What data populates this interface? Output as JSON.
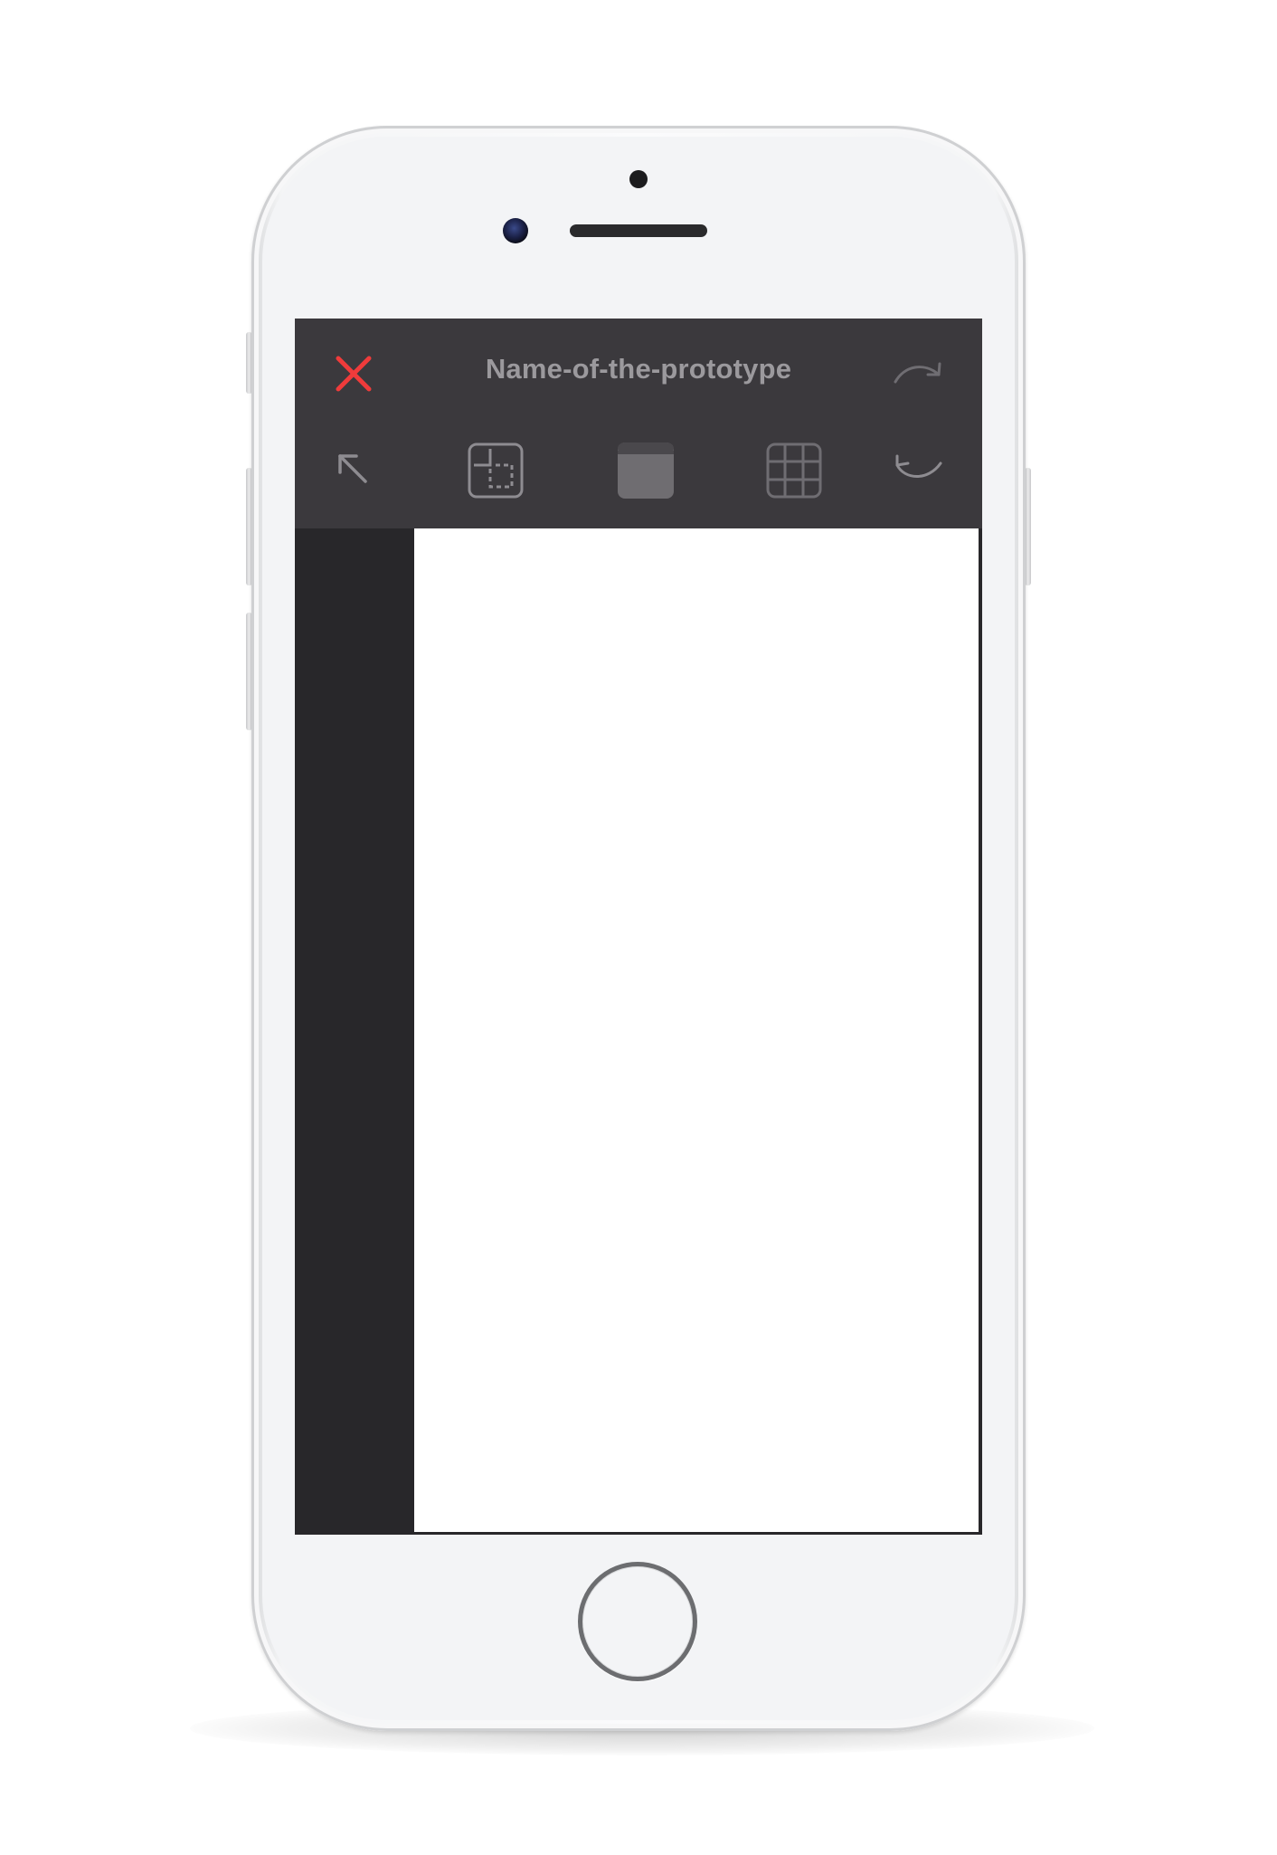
{
  "prototype": {
    "title": "Name-of-the-prototype"
  },
  "toolbar": {
    "top_row": [
      {
        "name": "close-icon",
        "color": "#ef3b3b"
      },
      {
        "name": "redo-icon"
      }
    ],
    "bottom_row": [
      {
        "name": "arrow-up-left-icon"
      },
      {
        "name": "crop-frame-icon"
      },
      {
        "name": "header-layout-icon"
      },
      {
        "name": "grid-icon"
      },
      {
        "name": "undo-icon"
      }
    ]
  },
  "colors": {
    "toolbar_bg": "#3b393d",
    "sidebar_bg": "#28272a",
    "canvas_bg": "#ffffff",
    "title_text": "#9b999d",
    "icon": "#8e8c91",
    "close_accent": "#ef3b3b"
  }
}
